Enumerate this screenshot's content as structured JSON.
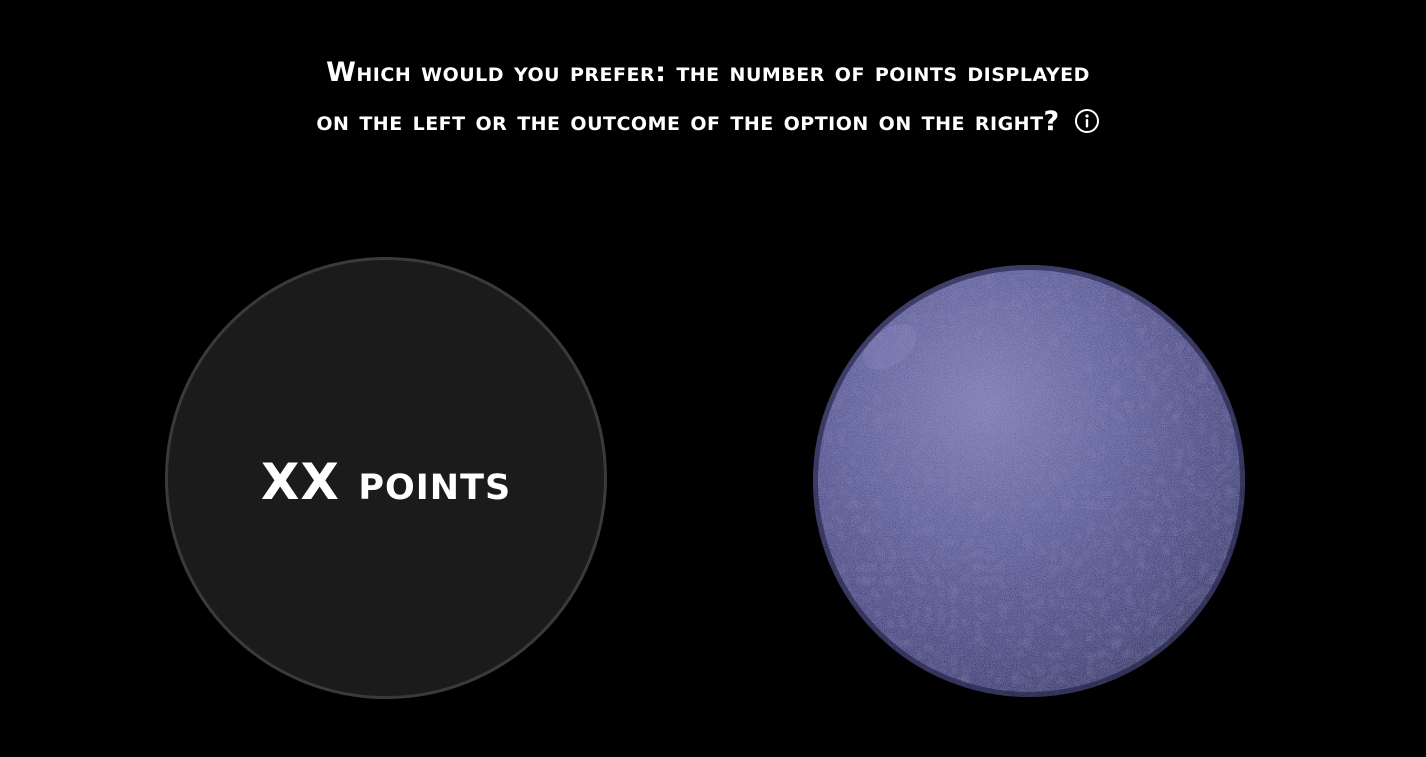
{
  "question": {
    "line1": "Which would you prefer: the number of points displayed",
    "line2": "on the left or the outcome of the option on the right?",
    "info_icon": "info-circle-icon"
  },
  "left_option": {
    "label": "XX points"
  },
  "right_option": {
    "image": "purple-rocky-sphere",
    "color": "#4a4a8c"
  },
  "colors": {
    "background": "#000000",
    "text": "#ffffff",
    "circle_fill": "#1b1b1b",
    "circle_border": "#3a3a3a"
  }
}
